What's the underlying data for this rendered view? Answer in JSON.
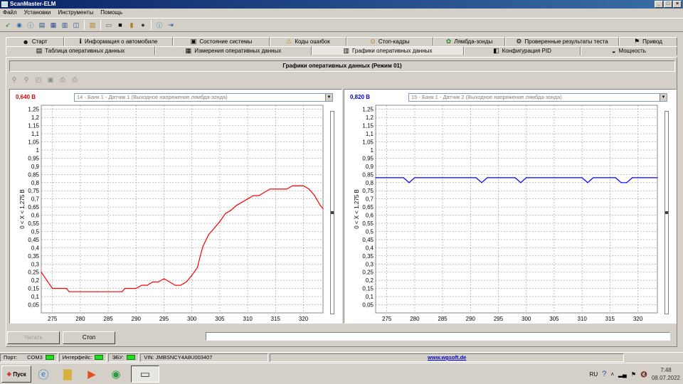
{
  "window": {
    "title": "ScanMaster-ELM",
    "min": "_",
    "max": "□",
    "close": "×"
  },
  "menu": [
    "Файл",
    "Установки",
    "Инструменты",
    "Помощь"
  ],
  "tabs_top": [
    {
      "label": "Старт",
      "icon": "start-icon",
      "glyph": "☻"
    },
    {
      "label": "Информация о автомобиле",
      "icon": "info-icon",
      "glyph": "ℹ"
    },
    {
      "label": "Состояние системы",
      "icon": "system-status-icon",
      "glyph": "▣"
    },
    {
      "label": "Коды ошибок",
      "icon": "warning-icon",
      "glyph": "⚠"
    },
    {
      "label": "Стоп-кадры",
      "icon": "freeze-frame-icon",
      "glyph": "⊙"
    },
    {
      "label": "Лямбда-зонды",
      "icon": "o2-sensor-icon",
      "glyph": "✿"
    },
    {
      "label": "Проверенные результаты теста",
      "icon": "test-results-icon",
      "glyph": "⚙"
    },
    {
      "label": "Привод",
      "icon": "drive-icon",
      "glyph": "⚑"
    }
  ],
  "tabs_bottom": [
    {
      "label": "Таблица оперативных данных",
      "icon": "table-icon",
      "glyph": "▤"
    },
    {
      "label": "Измерения оперативных данных",
      "icon": "measure-icon",
      "glyph": "▦"
    },
    {
      "label": "Графики оперативных данных",
      "icon": "chart-icon",
      "glyph": "▥",
      "active": true
    },
    {
      "label": "Конфигурация PID",
      "icon": "pid-config-icon",
      "glyph": "◧"
    },
    {
      "label": "Мощность",
      "icon": "power-icon",
      "glyph": "◒"
    }
  ],
  "panel_title": "Графики оперативных данных (Режим 01)",
  "buttons": {
    "read": "Читать",
    "stop": "Стоп"
  },
  "status": {
    "port_label": "Порт:",
    "port_value": "COM3",
    "interface_label": "Интерфейс:",
    "ecu_label": "ЭБУ:",
    "vin": "VIN: JMBSNCY4A8U003407",
    "url": "www.wgsoft.de"
  },
  "taskbar": {
    "start": "Пуск",
    "lang": "RU",
    "time": "7:48",
    "date": "08.07.2022"
  },
  "chart_data": [
    {
      "type": "line",
      "readout": "0,640 В",
      "sensor": "14 - Банк 1 - Датчик 1 (Выходное напряжение лямбда-зонда)",
      "ylabel": "0   < X <   1,275 В",
      "color": "#ff0000",
      "xlim": [
        273,
        323.5
      ],
      "ylim": [
        0,
        1.275
      ],
      "xticks": [
        275,
        280,
        285,
        290,
        295,
        300,
        305,
        310,
        315,
        320
      ],
      "yticks": [
        "0,05",
        "0,1",
        "0,15",
        "0,2",
        "0,25",
        "0,3",
        "0,35",
        "0,4",
        "0,45",
        "0,5",
        "0,55",
        "0,6",
        "0,65",
        "0,7",
        "0,75",
        "0,8",
        "0,85",
        "0,9",
        "0,95",
        "1",
        "1,05",
        "1,1",
        "1,15",
        "1,2",
        "1,25"
      ],
      "grid": true,
      "x": [
        273,
        274,
        275,
        276,
        277.5,
        278,
        280,
        283,
        286,
        287.5,
        288,
        290,
        291,
        292,
        293,
        294,
        295,
        296,
        297,
        298,
        299,
        300,
        301,
        301.5,
        302,
        303,
        304,
        305,
        306,
        307,
        308,
        309,
        310,
        311,
        312,
        313,
        314,
        315,
        316,
        317,
        318,
        319,
        320,
        321,
        322,
        323,
        323.5
      ],
      "y": [
        0.25,
        0.2,
        0.15,
        0.15,
        0.15,
        0.13,
        0.13,
        0.13,
        0.13,
        0.13,
        0.15,
        0.15,
        0.17,
        0.17,
        0.19,
        0.19,
        0.21,
        0.19,
        0.17,
        0.17,
        0.19,
        0.23,
        0.28,
        0.35,
        0.41,
        0.48,
        0.52,
        0.56,
        0.61,
        0.63,
        0.66,
        0.68,
        0.7,
        0.72,
        0.72,
        0.74,
        0.76,
        0.76,
        0.76,
        0.76,
        0.78,
        0.78,
        0.78,
        0.76,
        0.72,
        0.66,
        0.64
      ]
    },
    {
      "type": "line",
      "readout": "0,820 В",
      "sensor": "15 - Банк 1 - Датчик 2 (Выходное напряжение лямбда-зонда)",
      "ylabel": "0   < X <   1,275 В",
      "color": "#0000ff",
      "xlim": [
        273,
        323.5
      ],
      "ylim": [
        0,
        1.275
      ],
      "xticks": [
        275,
        280,
        285,
        290,
        295,
        300,
        305,
        310,
        315,
        320
      ],
      "yticks": [
        "0,05",
        "0,1",
        "0,15",
        "0,2",
        "0,25",
        "0,3",
        "0,35",
        "0,4",
        "0,45",
        "0,5",
        "0,55",
        "0,6",
        "0,65",
        "0,7",
        "0,75",
        "0,8",
        "0,85",
        "0,9",
        "0,95",
        "1",
        "1,05",
        "1,1",
        "1,15",
        "1,2",
        "1,25"
      ],
      "grid": true,
      "x": [
        273,
        278,
        279,
        280,
        291,
        292,
        293,
        298,
        299,
        300,
        310,
        311,
        312,
        316,
        317,
        318,
        319,
        323.5
      ],
      "y": [
        0.83,
        0.83,
        0.8,
        0.83,
        0.83,
        0.8,
        0.83,
        0.83,
        0.8,
        0.83,
        0.83,
        0.8,
        0.83,
        0.83,
        0.8,
        0.8,
        0.83,
        0.83
      ]
    }
  ]
}
